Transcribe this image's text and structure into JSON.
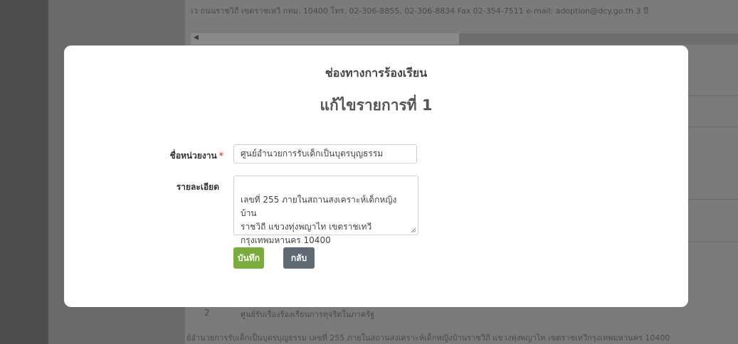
{
  "background": {
    "top_text": "เว ถนนราชวิถี เขตราชเทวี กทม. 10400 โทร. 02-306-8855, 02-306-8834 Fax 02-354-7511 e-mail: adoption@dcy.go.th   3 ปี",
    "row_number": "2",
    "row_name": "ศูนย์รับเรื่องร้องเรียนการทุจริตในภาครัฐ",
    "bottom_text": "ย์อำนวยการรับเด็กเป็นบุตรบุญธรรม    เลขที่ 255 ภายในสถานสงเคราะห์เด็กหญิงบ้านราชวิถี แขวงทุ่งพญาไท เขตราชเทวีกรุงเทพมหานคร 10400"
  },
  "modal": {
    "subtitle": "ช่องทางการร้องเรียน",
    "title": "แก้ไขรายการที่ 1",
    "fields": {
      "unit_label": "ชื่อหน่วยงาน",
      "required_mark": "*",
      "unit_value": "ศูนย์อำนวยการรับเด็กเป็นบุตรบุญธรรม",
      "detail_label": "รายละเอียด",
      "detail_value": "เลขที่ 255 ภายในสถานสงเคราะห์เด็กหญิงบ้าน\nราชวิถี แขวงทุ่งพญาไท เขตราชเทวี\nกรุงเทพมหานคร 10400"
    },
    "buttons": {
      "save": "บันทึก",
      "back": "กลับ"
    }
  }
}
